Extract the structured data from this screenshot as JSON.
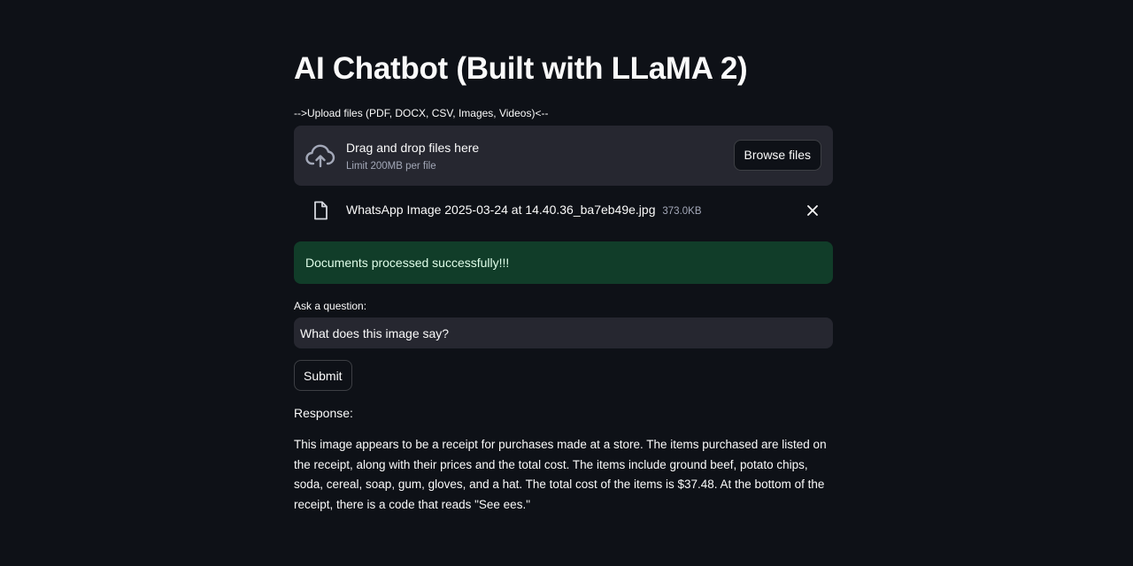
{
  "page": {
    "title": "AI Chatbot (Built with LLaMA 2)"
  },
  "uploader": {
    "label": "-->Upload files (PDF, DOCX, CSV, Images, Videos)<--",
    "drop_title": "Drag and drop files here",
    "drop_limit": "Limit 200MB per file",
    "browse_label": "Browse files",
    "icon": "cloud-upload-icon"
  },
  "uploaded_file": {
    "name": "WhatsApp Image 2025-03-24 at 14.40.36_ba7eb49e.jpg",
    "size": "373.0KB",
    "icon": "file-icon",
    "remove_icon": "close-icon"
  },
  "status": {
    "message": "Documents processed successfully!!!"
  },
  "question": {
    "label": "Ask a question:",
    "value": "What does this image say?"
  },
  "submit": {
    "label": "Submit"
  },
  "response": {
    "label": "Response:",
    "text": "This image appears to be a receipt for purchases made at a store. The items purchased are listed on the receipt, along with their prices and the total cost. The items include ground beef, potato chips, soda, cereal, soap, gum, gloves, and a hat. The total cost of the items is $37.48. At the bottom of the receipt, there is a code that reads \"See ees.\""
  },
  "colors": {
    "background": "#0e1117",
    "surface": "#262730",
    "success_bg": "#113d29",
    "text": "#fafafa",
    "muted_text": "#a3a8b8"
  }
}
